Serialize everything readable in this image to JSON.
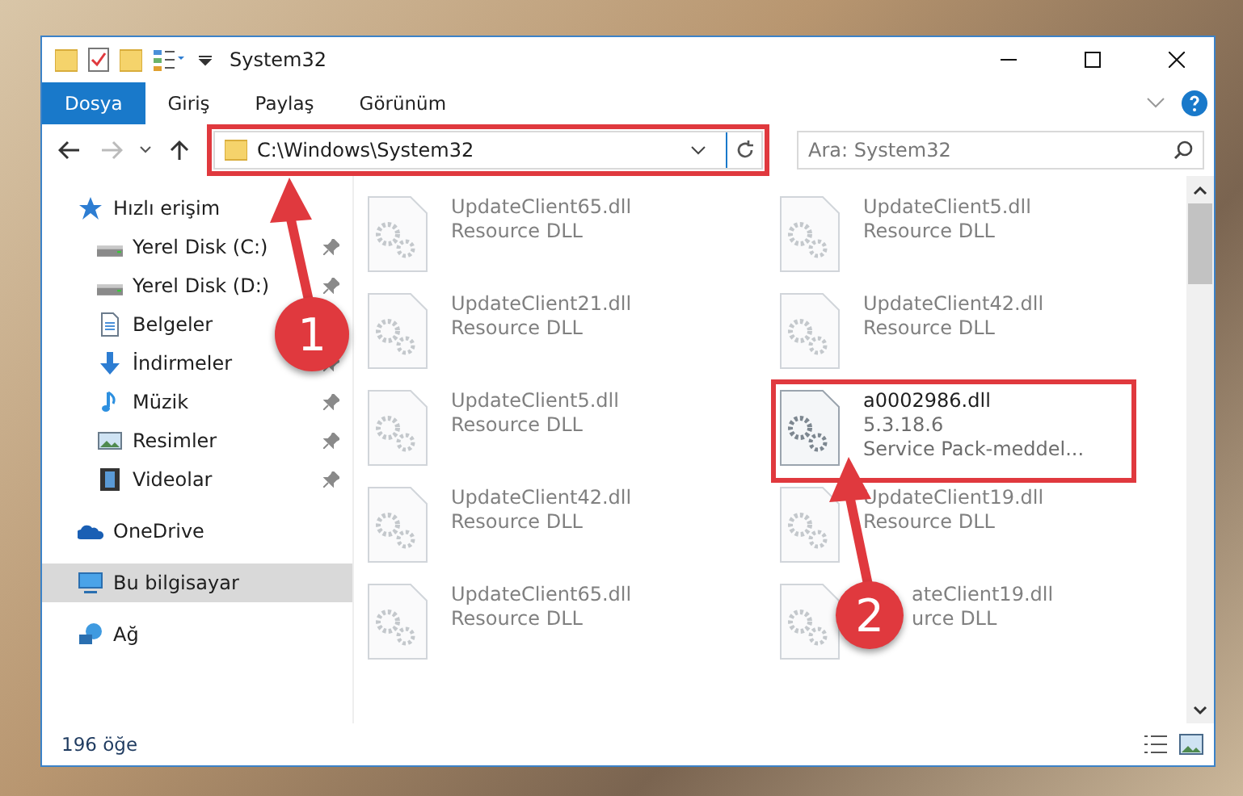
{
  "window": {
    "title": "System32"
  },
  "ribbon_tabs": [
    {
      "label": "Dosya",
      "selected": true
    },
    {
      "label": "Giriş",
      "selected": false
    },
    {
      "label": "Paylaş",
      "selected": false
    },
    {
      "label": "Görünüm",
      "selected": false
    }
  ],
  "address_bar": {
    "path": "C:\\Windows\\System32",
    "highlighted": true
  },
  "search": {
    "placeholder": "Ara: System32"
  },
  "navigation": [
    {
      "label": "Hızlı erişim",
      "kind": "star",
      "selected": false,
      "children": [
        {
          "label": "Yerel Disk (C:)",
          "kind": "drive",
          "pinned": true
        },
        {
          "label": "Yerel Disk (D:)",
          "kind": "drive",
          "pinned": true
        },
        {
          "label": "Belgeler",
          "kind": "document"
        },
        {
          "label": "İndirmeler",
          "kind": "download",
          "pinned": true
        },
        {
          "label": "Müzik",
          "kind": "music",
          "pinned": true
        },
        {
          "label": "Resimler",
          "kind": "picture",
          "pinned": true
        },
        {
          "label": "Videolar",
          "kind": "video",
          "pinned": true
        }
      ]
    },
    {
      "label": "OneDrive",
      "kind": "cloud",
      "selected": false
    },
    {
      "label": "Bu bilgisayar",
      "kind": "computer",
      "selected": true
    },
    {
      "label": "Ağ",
      "kind": "network",
      "selected": false
    }
  ],
  "files": [
    {
      "name": "UpdateClient65.dll",
      "details": [
        "Resource DLL"
      ],
      "blurred": true,
      "highlighted": false
    },
    {
      "name": "UpdateClient5.dll",
      "details": [
        "Resource DLL"
      ],
      "blurred": true,
      "highlighted": false
    },
    {
      "name": "UpdateClient21.dll",
      "details": [
        "Resource DLL"
      ],
      "blurred": true,
      "highlighted": false
    },
    {
      "name": "UpdateClient42.dll",
      "details": [
        "Resource DLL"
      ],
      "blurred": true,
      "highlighted": false
    },
    {
      "name": "UpdateClient5.dll",
      "details": [
        "Resource DLL"
      ],
      "blurred": true,
      "highlighted": false
    },
    {
      "name": "a0002986.dll",
      "details": [
        "5.3.18.6",
        "Service Pack-meddel..."
      ],
      "blurred": false,
      "highlighted": true
    },
    {
      "name": "UpdateClient42.dll",
      "details": [
        "Resource DLL"
      ],
      "blurred": true,
      "highlighted": false
    },
    {
      "name": "UpdateClient19.dll",
      "details": [
        "Resource DLL"
      ],
      "blurred": true,
      "highlighted": false
    },
    {
      "name": "UpdateClient65.dll",
      "details": [
        "Resource DLL"
      ],
      "blurred": true,
      "highlighted": false
    },
    {
      "name": "ateClient19.dll",
      "details": [
        "urce DLL"
      ],
      "blurred": true,
      "highlighted": false,
      "covered": true
    }
  ],
  "status_bar": {
    "item_count": "196 öğe"
  },
  "callouts": [
    {
      "number": "1"
    },
    {
      "number": "2"
    }
  ]
}
